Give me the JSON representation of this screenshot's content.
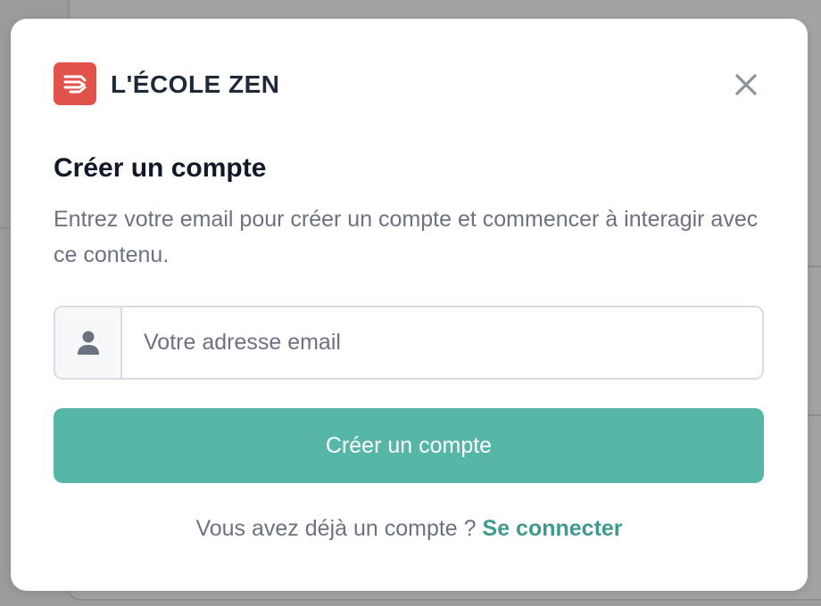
{
  "brand": {
    "name": "L'ÉCOLE ZEN",
    "logo_icon": "stacked-chevrons-logo",
    "logo_color": "#e0524a"
  },
  "modal": {
    "title": "Créer un compte",
    "description": "Entrez votre email pour créer un compte et commencer à interagir avec ce contenu.",
    "close_icon": "close-icon"
  },
  "email_field": {
    "icon": "user-icon",
    "placeholder": "Votre adresse email",
    "value": ""
  },
  "submit_button": {
    "label": "Créer un compte",
    "color": "#56b6a8"
  },
  "footer": {
    "prompt": "Vous avez déjà un compte ?",
    "link_label": "Se connecter",
    "link_color": "#3f9a8c"
  }
}
